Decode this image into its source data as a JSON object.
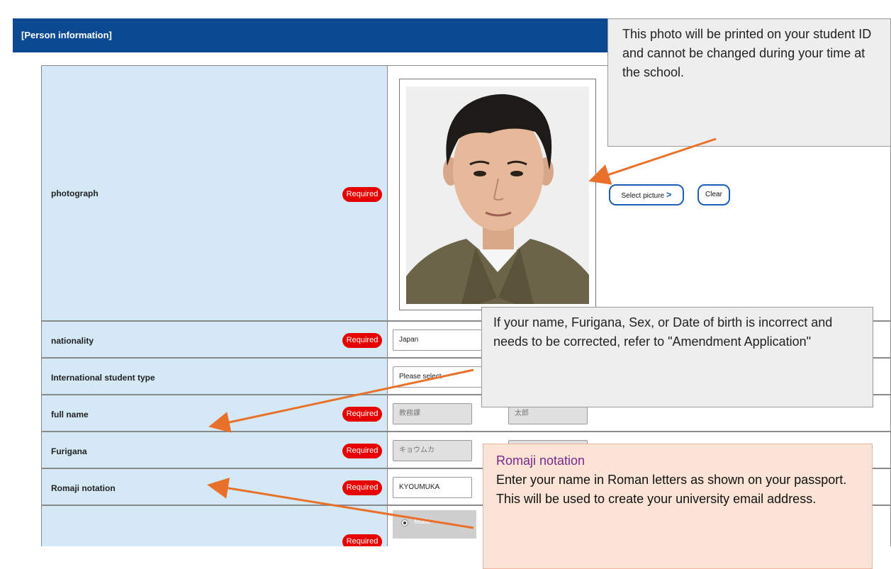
{
  "header": {
    "title": "[Person information]"
  },
  "rows": {
    "photograph": {
      "label": "photograph",
      "required": "Required"
    },
    "nationality": {
      "label": "nationality",
      "required": "Required",
      "value": "Japan"
    },
    "student_type": {
      "label": "International student type",
      "value": "Please select"
    },
    "full_name": {
      "label": "full name",
      "required": "Required",
      "last": "教務課",
      "first": "太郎"
    },
    "furigana": {
      "label": "Furigana",
      "required": "Required",
      "last": "キョウムカ"
    },
    "romaji": {
      "label": "Romaji notation",
      "required": "Required",
      "last": "KYOUMUKA"
    },
    "sex": {
      "required": "Required",
      "option_male": "Male"
    }
  },
  "buttons": {
    "select_picture": "Select picture",
    "select_picture_icon": "chevron-right-icon",
    "clear": "Clear"
  },
  "callouts": {
    "photo_note": "This photo will be printed on your student ID and cannot be changed during your time at the school.",
    "amendment_note": "If your name, Furigana, Sex, or Date of birth is incorrect and needs to be corrected, refer to \"Amendment Application\"",
    "romaji_title": "Romaji notation",
    "romaji_note": "Enter your name in Roman letters as shown on your passport. This will be used to create your university email address."
  },
  "colors": {
    "header": "#0b4a93",
    "required": "#e60000",
    "label_bg": "#d4e8f5",
    "arrow": "#e8702a",
    "romaji_title": "#7a2a8c"
  }
}
